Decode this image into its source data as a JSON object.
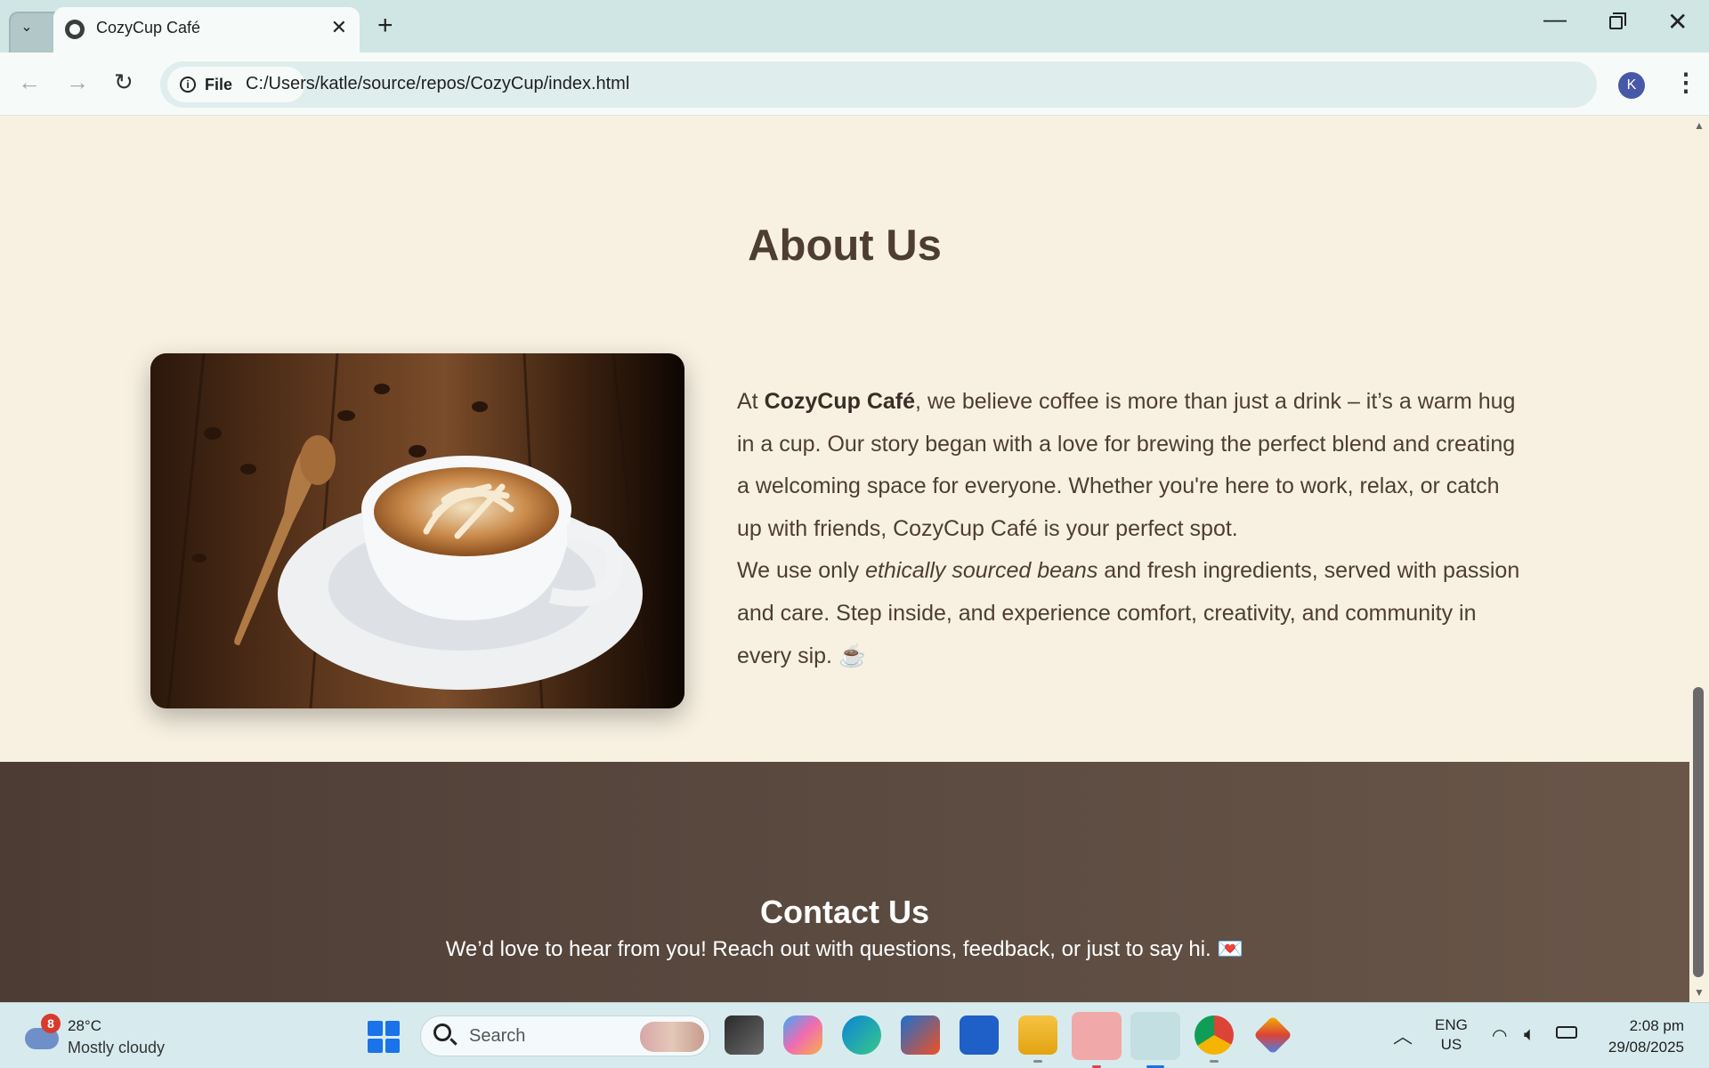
{
  "browser": {
    "tab_title": "CozyCup Café",
    "site_chip_label": "File",
    "url": "C:/Users/katle/source/repos/CozyCup/index.html",
    "profile_initial": "K"
  },
  "page": {
    "about": {
      "heading": "About Us",
      "image_alt": "Latte art coffee cup on saucer with coffee beans and wooden spoon",
      "p1_a": "At ",
      "p1_brand": "CozyCup Café",
      "p1_b": ", we believe coffee is more than just a drink – it’s a warm hug in a cup. Our story began with a love for brewing the perfect blend and creating a welcoming space for everyone. Whether you're here to work, relax, or catch up with friends, CozyCup Café is your perfect spot.",
      "p2_a": "We use only ",
      "p2_em": "ethically sourced beans",
      "p2_b": " and fresh ingredients, served with passion and care. Step inside, and experience comfort, creativity, and community in every sip.",
      "p2_emoji": "☕"
    },
    "contact": {
      "heading": "Contact Us",
      "text": "We’d love to hear from you! Reach out with questions, feedback, or just to say hi.",
      "emoji": "💌"
    }
  },
  "taskbar": {
    "weather_badge": "8",
    "weather_temp": "28°C",
    "weather_desc": "Mostly cloudy",
    "search_label": "Search",
    "lang_line1": "ENG",
    "lang_line2": "US",
    "time": "2:08 pm",
    "date": "29/08/2025",
    "apps": [
      "task-view",
      "copilot",
      "edge",
      "microsoft-store",
      "azure-data-studio",
      "file-explorer",
      "sticky-notes",
      "chrome",
      "chrome-profile-2",
      "gemini"
    ]
  },
  "colors": {
    "page_bg": "#f8f1e2",
    "heading_brown": "#4e3d33",
    "contact_bg": "#5a4a40",
    "browser_frame": "#cfe6e4"
  }
}
